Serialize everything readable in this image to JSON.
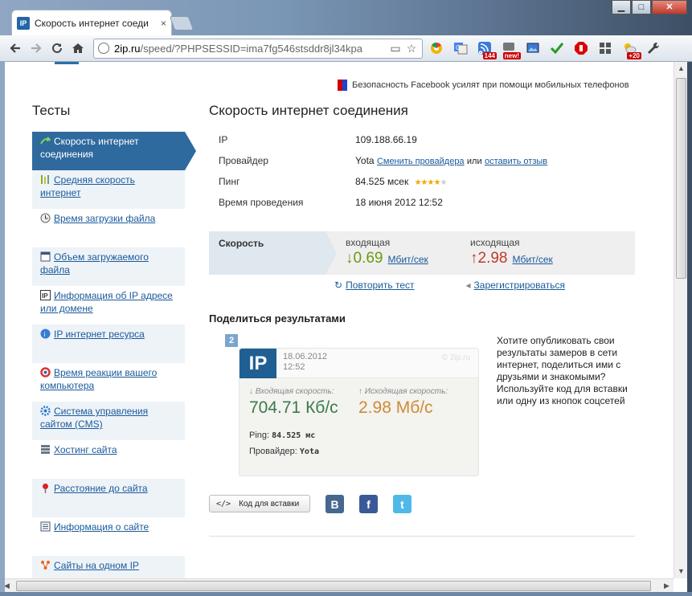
{
  "browser": {
    "tab_title": "Скорость интернет соеди",
    "tab_icon": "IP",
    "tab_close": "×",
    "window_controls": {
      "minimize": "▁",
      "maximize": "□",
      "close": "✕"
    },
    "url_host": "2ip.ru",
    "url_rest": "/speed/?PHPSESSID=ima7fg546stsddr8jl34kpa",
    "ext_badges": {
      "ext3": "144",
      "ext4": "new!",
      "ext10": "+20"
    }
  },
  "news": {
    "text": "Безопасность Facebook усилят при помощи мобильных телефонов"
  },
  "sidebar": {
    "title": "Тесты",
    "items": [
      {
        "label": "Скорость интернет соединения",
        "icon": "arrow-icon"
      },
      {
        "label": "Средняя скорость интернет",
        "icon": "bars-icon"
      },
      {
        "label": "Время загрузки файла",
        "icon": "clock-icon"
      },
      {
        "label": "Объем загружаемого файла",
        "icon": "window-icon"
      },
      {
        "label": "Информация об IP адресе или домене",
        "icon": "ip-icon"
      },
      {
        "label": "IP интернет ресурса",
        "icon": "globe-icon"
      },
      {
        "label": "Время реакции вашего компьютера",
        "icon": "refresh-icon"
      },
      {
        "label": "Система управления сайтом (CMS)",
        "icon": "gear-icon"
      },
      {
        "label": "Хостинг сайта",
        "icon": "server-icon"
      },
      {
        "label": "Расстояние до сайта",
        "icon": "pin-icon"
      },
      {
        "label": "Информация о сайте",
        "icon": "doc-icon"
      },
      {
        "label": "Сайты на одном IP",
        "icon": "network-icon"
      }
    ]
  },
  "main": {
    "title": "Скорость интернет соединения",
    "info": {
      "ip_label": "IP",
      "ip_value": "109.188.66.19",
      "provider_label": "Провайдер",
      "provider_value": "Yota",
      "change_provider": "Сменить провайдера",
      "or": "или",
      "leave_review": "оставить отзыв",
      "ping_label": "Пинг",
      "ping_value": "84.525 мсек",
      "ping_rating": 4,
      "time_label": "Время проведения",
      "time_value": "18 июня 2012 12:52"
    },
    "speed": {
      "label": "Скорость",
      "in_label": "входящая",
      "in_value": "0.69",
      "in_unit": "Мбит/сек",
      "in_arrow": "↓",
      "out_label": "исходящая",
      "out_value": "2.98",
      "out_unit": "Мбит/сек",
      "out_arrow": "↑"
    },
    "actions": {
      "repeat": "Повторить тест",
      "register": "Зарегистрироваться"
    },
    "share": {
      "title": "Поделиться результатами",
      "text": "Хотите опубликовать свои результаты замеров в сети интернет, поделиться ими с друзьями и знакомыми? Используйте код для вставки или одну из кнопок соцсетей",
      "embed_button": "Код для вставки",
      "embed_icon": "</>",
      "social": {
        "vk": "В",
        "fb": "f",
        "tw": "t"
      }
    },
    "card": {
      "number": "2",
      "logo": "IP",
      "date": "18.06.2012",
      "time": "12:52",
      "watermark": "© 2ip.ru",
      "in_label": "↓ Входящая скорость:",
      "in_value": "704.71 Кб/с",
      "out_label": "↑ Исходящая скорость:",
      "out_value": "2.98 Мб/с",
      "ping_label": "Ping:",
      "ping_value": "84.525 мс",
      "provider_label": "Провайдер:",
      "provider_value": "Yota"
    }
  }
}
